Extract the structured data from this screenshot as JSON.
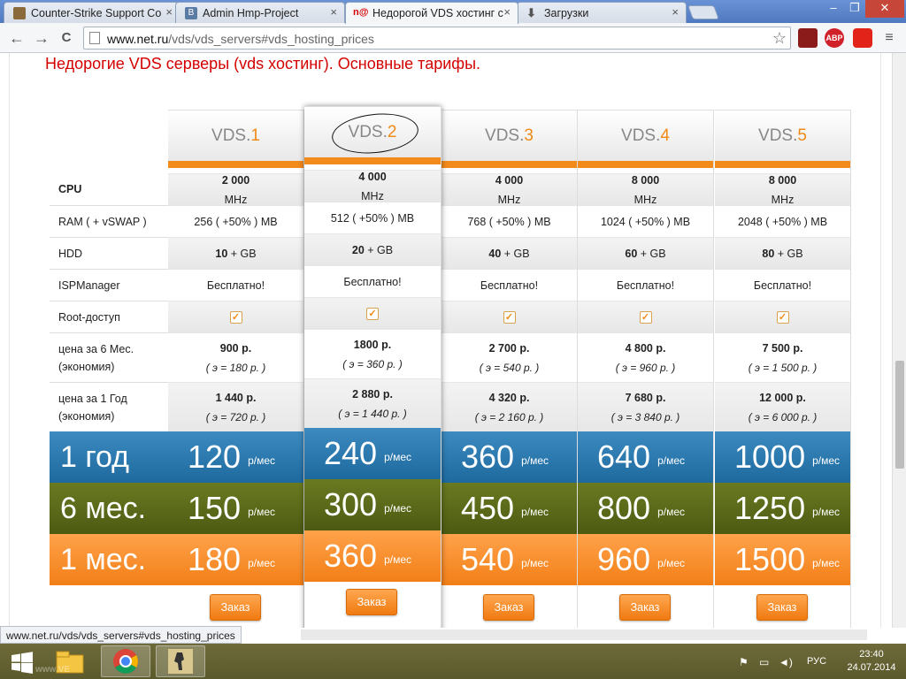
{
  "tabs": [
    {
      "title": "Counter-Strike Support Co",
      "close": "×"
    },
    {
      "title": "Admin Hmp-Project",
      "close": "×"
    },
    {
      "title": "Недорогой VDS хостинг с",
      "close": "×"
    },
    {
      "title": "Загрузки",
      "close": "×"
    }
  ],
  "window": {
    "minimize": "–",
    "restore": "❐",
    "close": "✕"
  },
  "toolbar": {
    "url_host": "www.net.ru",
    "url_path": "/vds/vds_servers#vds_hosting_prices",
    "back": "←",
    "forward": "→",
    "reload": "C",
    "star": "☆",
    "ext_abp": "ABP"
  },
  "page": {
    "heading": "Недорогие VDS серверы (vds хостинг). Основные тарифы.",
    "labels": {
      "cpu": "CPU",
      "ram": "RAM ( + vSWAP )",
      "hdd": "HDD",
      "ispmanager": "ISPManager",
      "root": "Root-доступ",
      "price6_line1": "цена за 6 Мес.",
      "price6_line2": "(экономия)",
      "price1y_line1": "цена за 1 Год",
      "price1y_line2": "(экономия)",
      "year": "1 год",
      "six": "6 мес.",
      "month": "1 мес."
    },
    "price_unit": "р/мес",
    "order_label": "Заказ",
    "plans": [
      {
        "name": "VDS.",
        "num": "1",
        "cpu_val": "2 000",
        "cpu_unit": " MHz",
        "ram": "256 ( +50% ) MB",
        "hdd_val": "10",
        "hdd_unit": " + GB",
        "isp": "Бесплатно!",
        "p6": "900 р.",
        "p6_save": "( э = 180 р. )",
        "p12": "1 440 р.",
        "p12_save": "( э = 720 р. )",
        "year": "120",
        "six": "150",
        "month": "180"
      },
      {
        "name": "VDS.",
        "num": "2",
        "cpu_val": "4 000",
        "cpu_unit": " MHz",
        "ram": "512 ( +50% ) MB",
        "hdd_val": "20",
        "hdd_unit": " + GB",
        "isp": "Бесплатно!",
        "p6": "1800 р.",
        "p6_save": "( э = 360 р. )",
        "p12": "2 880 р.",
        "p12_save": "( э = 1 440 р. )",
        "year": "240",
        "six": "300",
        "month": "360"
      },
      {
        "name": "VDS.",
        "num": "3",
        "cpu_val": "4 000",
        "cpu_unit": " MHz",
        "ram": "768 ( +50% ) MB",
        "hdd_val": "40",
        "hdd_unit": " + GB",
        "isp": "Бесплатно!",
        "p6": "2 700 р.",
        "p6_save": "( э = 540 р. )",
        "p12": "4 320 р.",
        "p12_save": "( э = 2 160 р. )",
        "year": "360",
        "six": "450",
        "month": "540"
      },
      {
        "name": "VDS.",
        "num": "4",
        "cpu_val": "8 000",
        "cpu_unit": " MHz",
        "ram": "1024 ( +50% ) MB",
        "hdd_val": "60",
        "hdd_unit": " + GB",
        "isp": "Бесплатно!",
        "p6": "4 800 р.",
        "p6_save": "( э = 960 р. )",
        "p12": "7 680 р.",
        "p12_save": "( э = 3 840 р. )",
        "year": "640",
        "six": "800",
        "month": "960"
      },
      {
        "name": "VDS.",
        "num": "5",
        "cpu_val": "8 000",
        "cpu_unit": " MHz",
        "ram": "2048 ( +50% ) MB",
        "hdd_val": "80",
        "hdd_unit": " + GB",
        "isp": "Бесплатно!",
        "p6": "7 500 р.",
        "p6_save": "( э = 1 500 р. )",
        "p12": "12 000 р.",
        "p12_save": "( э = 6 000 р. )",
        "year": "1000",
        "six": "1250",
        "month": "1500"
      }
    ],
    "highlighted_plan": 2
  },
  "status_url": "www.net.ru/vds/vds_servers#vds_hosting_prices",
  "taskbar": {
    "lang": "РУС",
    "time": "23:40",
    "date": "24.07.2014",
    "watermark": "www.VE"
  },
  "colors": {
    "accent_orange": "#f28a1c",
    "year_blue": "#1e6a9f",
    "six_olive": "#4c5a12",
    "month_orange": "#f27f17",
    "heading_red": "#d40000"
  },
  "icons": [
    "counter-strike-favicon",
    "vk-favicon",
    "netru-favicon",
    "download-icon",
    "star-icon",
    "abp-icon",
    "windows-start-icon",
    "explorer-icon",
    "chrome-icon",
    "cs-icon"
  ]
}
